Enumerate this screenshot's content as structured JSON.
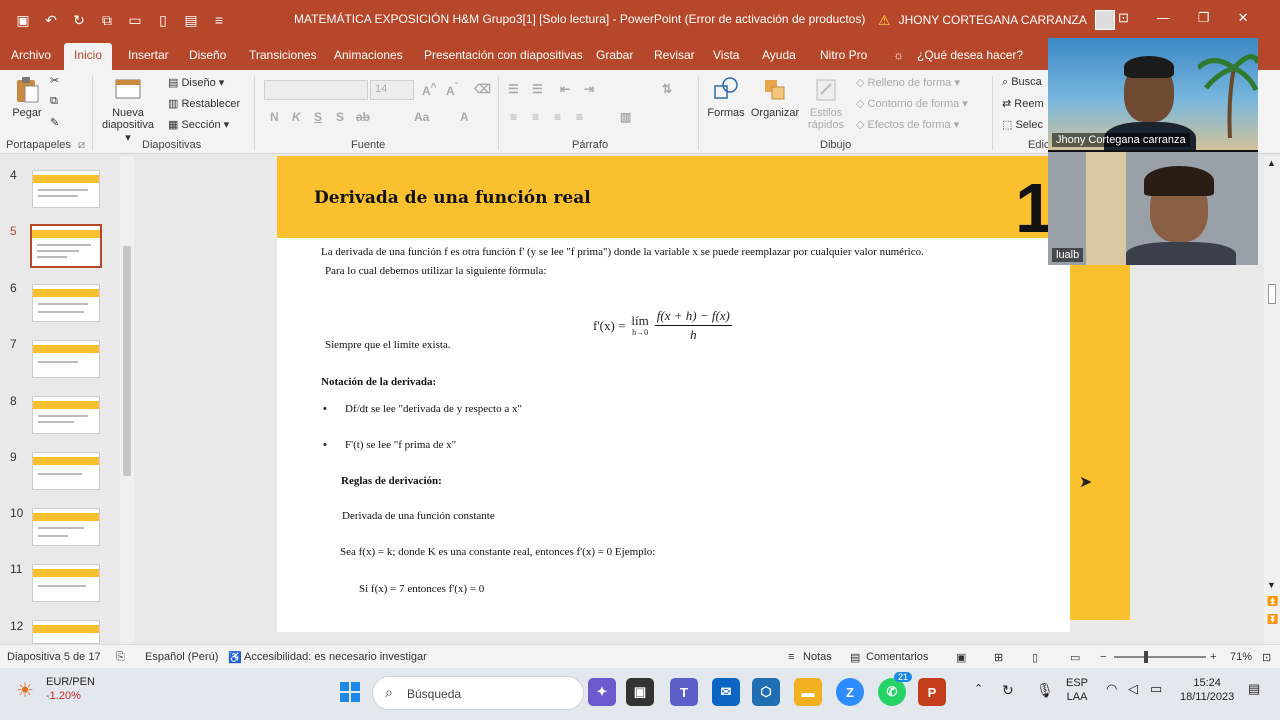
{
  "window": {
    "title": "MATEMÁTICA EXPOSICIÓN H&M Grupo3[1] [Solo lectura]  -  PowerPoint (Error de activación de productos)",
    "user": "JHONY CORTEGANA CARRANZA"
  },
  "tabs": [
    "Archivo",
    "Inicio",
    "Insertar",
    "Diseño",
    "Transiciones",
    "Animaciones",
    "Presentación con diapositivas",
    "Grabar",
    "Revisar",
    "Vista",
    "Ayuda",
    "Nitro Pro",
    "¿Qué desea hacer?"
  ],
  "ribbon": {
    "portapapeles": {
      "paste": "Pegar",
      "label": "Portapapeles"
    },
    "diapositivas": {
      "new_slide_1": "Nueva",
      "new_slide_2": "diapositiva",
      "layout": "Diseño",
      "reset": "Restablecer",
      "section": "Sección",
      "label": "Diapositivas"
    },
    "fuente": {
      "size": "14",
      "label": "Fuente",
      "bold": "N",
      "italic": "K",
      "underline": "S",
      "strike": "S",
      "spacing": "ab",
      "case": "Aa",
      "color": "A"
    },
    "parrafo": {
      "label": "Párrafo"
    },
    "dibujo": {
      "shapes": "Formas",
      "arrange": "Organizar",
      "styles_1": "Estilos",
      "styles_2": "rápidos",
      "fill": "Relleno de forma",
      "outline": "Contorno de forma",
      "effects": "Efectos de forma",
      "label": "Dibujo"
    },
    "edicion": {
      "find": "Busca",
      "replace": "Reem",
      "select": "Selec",
      "label": "Edic"
    }
  },
  "thumbnails": [
    {
      "num": "4",
      "active": false
    },
    {
      "num": "5",
      "active": true
    },
    {
      "num": "6",
      "active": false
    },
    {
      "num": "7",
      "active": false
    },
    {
      "num": "8",
      "active": false
    },
    {
      "num": "9",
      "active": false
    },
    {
      "num": "10",
      "active": false
    },
    {
      "num": "11",
      "active": false
    },
    {
      "num": "12",
      "active": false
    }
  ],
  "slide": {
    "title": "Derivada de una función real",
    "number": "1",
    "line1": "La derivada de una función f es otra función f' (y se lee \"f prima\") donde la variable x se puede reemplazar por cualquier valor numérico.",
    "line2": "Para lo cual debemos utilizar la siguiente fórmula:",
    "formula": {
      "lhs": "f'(x) =",
      "lim": "lím",
      "lim_sub": "h→0",
      "numerator": "f(x + h) − f(x)",
      "denominator": "h"
    },
    "line3": "Siempre que el límite exista.",
    "notation_heading": "Notación de la derivada:",
    "bullet_glyph": "•",
    "bullet1": "Df/dt se lee \"derivada de y respecto a x\"",
    "bullet2": "F'(t) se lee \"f prima de x\"",
    "rules_heading": "Reglas de derivación:",
    "rule1": "Derivada de una función constante",
    "rule1_text": "Sea f(x) = k; donde K es una constante real, entonces f'(x) = 0 Ejemplo:",
    "rule1_example": "Si f(x) = 7 entonces f'(x) = 0"
  },
  "video": {
    "participant1": "Jhony Cortegana carranza",
    "participant2": "lualb"
  },
  "statusbar": {
    "slide_info": "Diapositiva 5 de 17",
    "language": "Español (Perú)",
    "accessibility": "Accesibilidad: es necesario investigar",
    "notes": "Notas",
    "comments": "Comentarios",
    "zoom": "71%"
  },
  "taskbar": {
    "weather_title": "EUR/PEN",
    "weather_value": "-1.20%",
    "search": "Búsqueda",
    "whatsapp_badge": "21",
    "lang_1": "ESP",
    "lang_2": "LAA",
    "time": "15:24",
    "date": "18/11/2023"
  },
  "colors": {
    "accent": "#b7472a",
    "slide_yellow": "#fbc02d"
  }
}
